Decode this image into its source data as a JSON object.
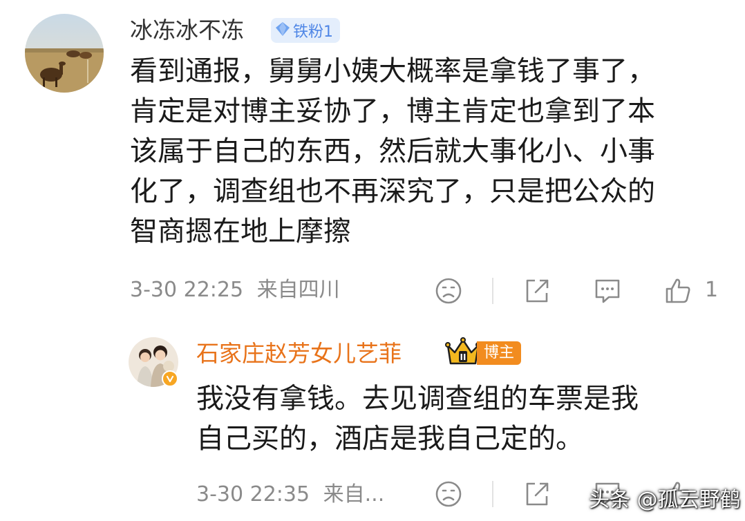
{
  "comment": {
    "username": "冰冻冰不冻",
    "fan_badge": "铁粉1",
    "lines": [
      "看到通报，舅舅小姨大概率是拿钱了事了，",
      "肯定是对博主妥协了，博主肯定也拿到了本",
      "该属于自己的东西，然后就大事化小、小事",
      "化了，调查组也不再深究了，只是把公众的",
      "智商摁在地上摩擦"
    ],
    "time": "3-30 22:25",
    "location": "来自四川",
    "like_count": "1",
    "icons": [
      "dislike-icon",
      "share-icon",
      "comment-icon",
      "like-icon"
    ]
  },
  "reply": {
    "username": "石家庄赵芳女儿艺菲",
    "username_color": "#e8731a",
    "role_badge": "博主",
    "crown_level": "II",
    "lines": [
      "我没有拿钱。去见调查组的车票是我",
      "自己买的，酒店是我自己定的。"
    ],
    "time": "3-30 22:35",
    "location": "来自...",
    "icons": [
      "dislike-icon",
      "share-icon",
      "comment-icon",
      "like-icon"
    ]
  },
  "watermark": "头条 @孤云野鹤",
  "colors": {
    "meta_gray": "#8a8a8a",
    "fan_badge_text": "#4f86e6",
    "blogger_badge_bg": "#f28c1f"
  }
}
